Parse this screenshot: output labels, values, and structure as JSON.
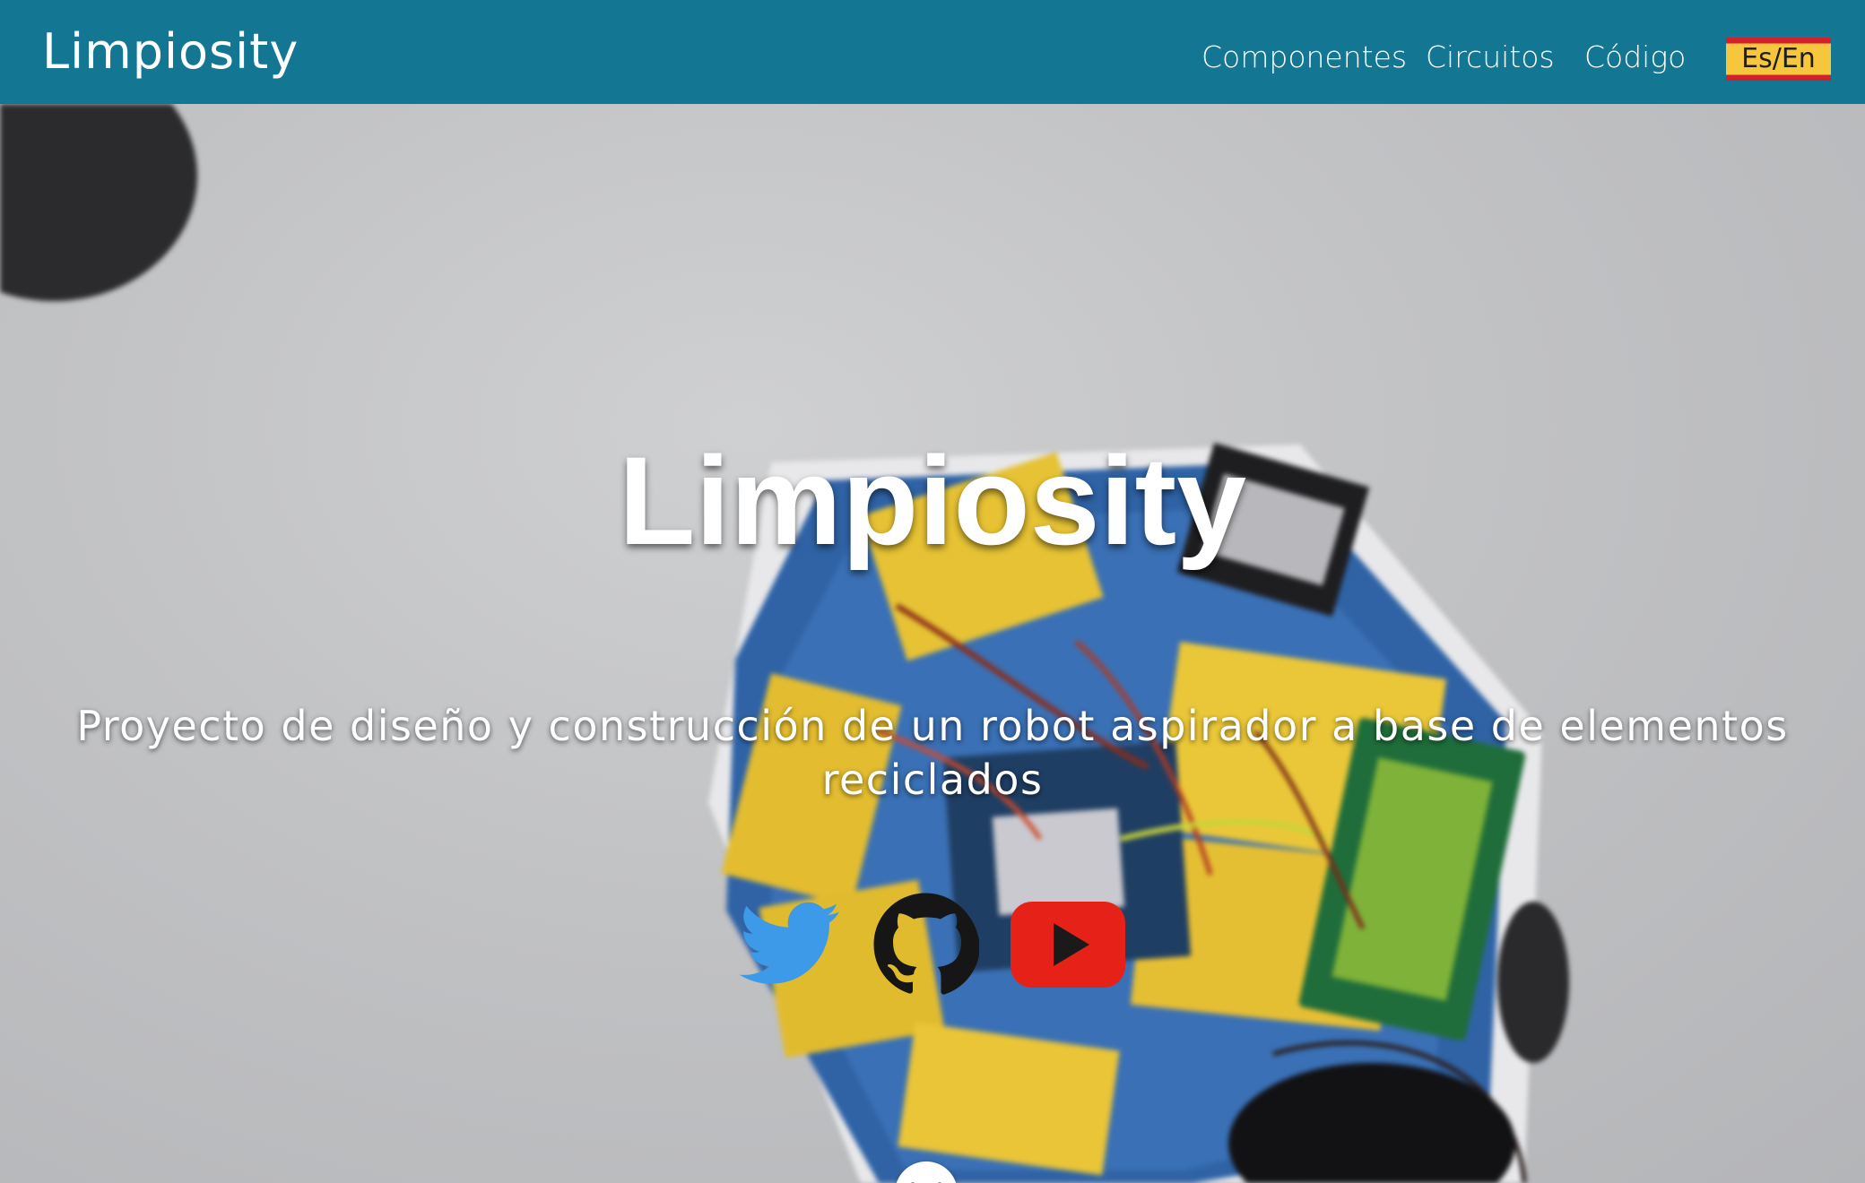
{
  "header": {
    "brand": "Limpiosity",
    "nav": [
      {
        "label": "Componentes"
      },
      {
        "label": "Circuitos"
      },
      {
        "label": "Código"
      }
    ],
    "language_toggle": "Es/En"
  },
  "hero": {
    "title": "Limpiosity",
    "subtitle": "Proyecto de diseño y construcción de un robot aspirador a base de elementos reciclados",
    "social": [
      {
        "icon": "twitter-icon",
        "color": "#3d9ae8"
      },
      {
        "icon": "github-icon",
        "color": "#161616"
      },
      {
        "icon": "youtube-icon",
        "color": "#e62117"
      }
    ],
    "scroll_icon": "chevron-down-icon"
  },
  "colors": {
    "header_bg": "#137693",
    "flag_red": "#d2212c",
    "flag_yellow": "#f6c63c"
  }
}
